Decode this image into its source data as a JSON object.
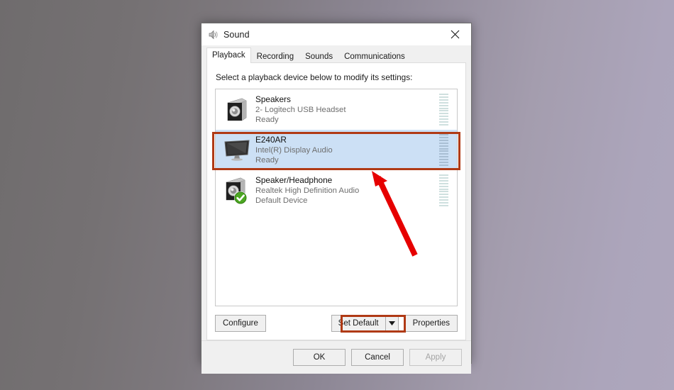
{
  "window": {
    "title": "Sound",
    "title_icon": "sound-speaker-icon",
    "close_icon": "close-icon"
  },
  "tabs": [
    {
      "label": "Playback",
      "active": true
    },
    {
      "label": "Recording",
      "active": false
    },
    {
      "label": "Sounds",
      "active": false
    },
    {
      "label": "Communications",
      "active": false
    }
  ],
  "panel": {
    "instruction": "Select a playback device below to modify its settings:"
  },
  "devices": [
    {
      "name": "Speakers",
      "driver": "2- Logitech USB Headset",
      "status": "Ready",
      "icon": "speaker-box-icon",
      "selected": false,
      "default_badge": false
    },
    {
      "name": "E240AR",
      "driver": "Intel(R) Display Audio",
      "status": "Ready",
      "icon": "monitor-icon",
      "selected": true,
      "default_badge": false
    },
    {
      "name": "Speaker/Headphone",
      "driver": "Realtek High Definition Audio",
      "status": "Default Device",
      "icon": "speaker-box-icon",
      "selected": false,
      "default_badge": true
    }
  ],
  "buttons": {
    "configure": "Configure",
    "set_default": "Set Default",
    "set_default_arrow_icon": "chevron-down-icon",
    "properties": "Properties",
    "ok": "OK",
    "cancel": "Cancel",
    "apply": "Apply"
  },
  "annotations": {
    "highlight_color": "#b03a15",
    "arrow_color": "#e60000",
    "targets": [
      "selected-device-row",
      "set-default-button"
    ]
  }
}
